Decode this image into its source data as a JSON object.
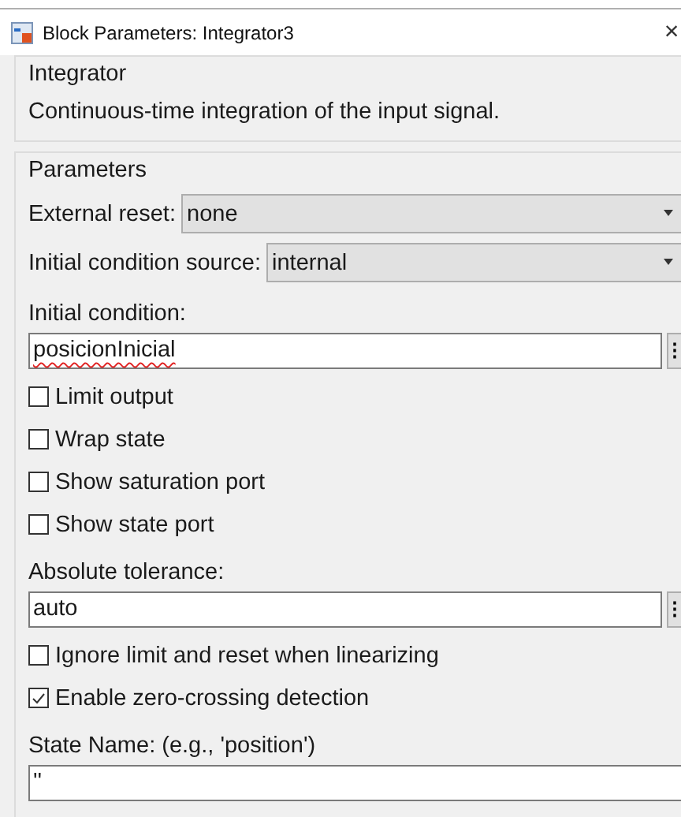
{
  "window": {
    "title": "Block Parameters: Integrator3",
    "close": "×"
  },
  "block": {
    "name": "Integrator",
    "description": "Continuous-time integration of the input signal."
  },
  "parameters": {
    "title": "Parameters",
    "items": [
      {
        "kind": "dropdown",
        "label": "External reset:",
        "value": "none"
      },
      {
        "kind": "dropdown",
        "label": "Initial condition source:",
        "value": "internal"
      },
      {
        "kind": "field",
        "label": "Initial condition:",
        "value": "posicionInicial",
        "misspelled": true,
        "more": "⋮"
      },
      {
        "kind": "checkbox",
        "label": "Limit output",
        "checked": false
      },
      {
        "kind": "checkbox",
        "label": "Wrap state",
        "checked": false
      },
      {
        "kind": "checkbox",
        "label": "Show saturation port",
        "checked": false
      },
      {
        "kind": "checkbox",
        "label": "Show state port",
        "checked": false
      },
      {
        "kind": "field",
        "label": "Absolute tolerance:",
        "value": "auto",
        "misspelled": false,
        "more": "⋮"
      },
      {
        "kind": "checkbox",
        "label": "Ignore limit and reset when linearizing",
        "checked": false
      },
      {
        "kind": "checkbox",
        "label": "Enable zero-crossing detection",
        "checked": true
      },
      {
        "kind": "field",
        "label": "State Name: (e.g., 'position')",
        "value": "''",
        "misspelled": false
      }
    ]
  }
}
